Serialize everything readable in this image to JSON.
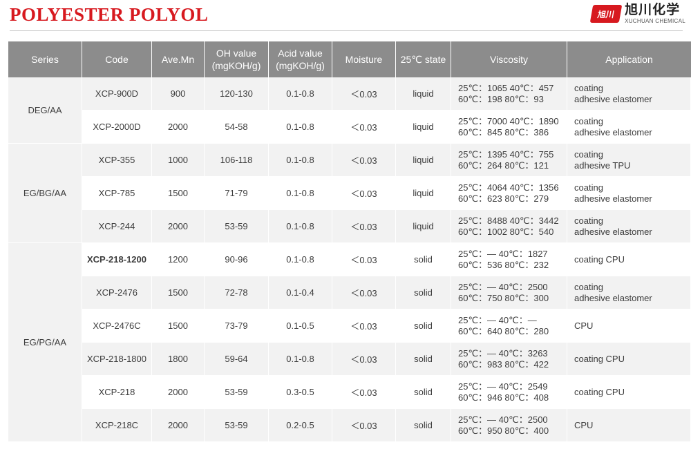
{
  "header": {
    "title": "POLYESTER POLYOL",
    "logo_badge": "旭川",
    "logo_cn": "旭川化学",
    "logo_en": "XUCHUAN CHEMICAL"
  },
  "table": {
    "headers": [
      "Series",
      "Code",
      "Ave.Mn",
      "OH value\n(mgKOH/g)",
      "Acid value\n(mgKOH/g)",
      "Moisture",
      "25℃ state",
      "Viscosity",
      "Application"
    ],
    "groups": [
      {
        "series": "DEG/AA",
        "rows": [
          {
            "code": "XCP-900D",
            "mn": "900",
            "oh": "120-130",
            "acid": "0.1-0.8",
            "moisture": "＜0.03",
            "state": "liquid",
            "visc1": "25℃：1065   40℃：457",
            "visc2": "60℃：198     80℃：93",
            "app1": "coating",
            "app2": "adhesive elastomer"
          },
          {
            "code": "XCP-2000D",
            "mn": "2000",
            "oh": "54-58",
            "acid": "0.1-0.8",
            "moisture": "＜0.03",
            "state": "liquid",
            "visc1": "25℃：7000   40℃：1890",
            "visc2": "60℃：845     80℃：386",
            "app1": "coating",
            "app2": "adhesive elastomer"
          }
        ]
      },
      {
        "series": "EG/BG/AA",
        "rows": [
          {
            "code": "XCP-355",
            "mn": "1000",
            "oh": "106-118",
            "acid": "0.1-0.8",
            "moisture": "＜0.03",
            "state": "liquid",
            "visc1": "25℃：1395  40℃：755",
            "visc2": "60℃：264    80℃：121",
            "app1": "coating",
            "app2": "adhesive TPU"
          },
          {
            "code": "XCP-785",
            "mn": "1500",
            "oh": "71-79",
            "acid": "0.1-0.8",
            "moisture": "＜0.03",
            "state": "liquid",
            "visc1": "25℃：4064 40℃：1356",
            "visc2": "60℃：623    80℃：279",
            "app1": "coating",
            "app2": "adhesive elastomer"
          },
          {
            "code": "XCP-244",
            "mn": "2000",
            "oh": "53-59",
            "acid": "0.1-0.8",
            "moisture": "＜0.03",
            "state": "liquid",
            "visc1": "25℃：8488  40℃：3442",
            "visc2": "60℃：1002  80℃：540",
            "app1": "coating",
            "app2": "adhesive elastomer"
          }
        ]
      },
      {
        "series": "EG/PG/AA",
        "rows": [
          {
            "code": "XCP-218-1200",
            "bold": true,
            "mn": "1200",
            "oh": "90-96",
            "acid": "0.1-0.8",
            "moisture": "＜0.03",
            "state": "solid",
            "visc1": "25℃：—      40℃：1827",
            "visc2": "60℃：536  80℃：232",
            "app1": "coating CPU",
            "app2": ""
          },
          {
            "code": "XCP-2476",
            "mn": "1500",
            "oh": "72-78",
            "acid": "0.1-0.4",
            "moisture": "＜0.03",
            "state": "solid",
            "visc1": "25℃：—     40℃：2500",
            "visc2": "60℃：750  80℃：300",
            "app1": "coating",
            "app2": "adhesive elastomer"
          },
          {
            "code": "XCP-2476C",
            "mn": "1500",
            "oh": "73-79",
            "acid": "0.1-0.5",
            "moisture": "＜0.03",
            "state": "solid",
            "visc1": "25℃：—      40℃：—",
            "visc2": "60℃：640  80℃：280",
            "app1": "CPU",
            "app2": ""
          },
          {
            "code": "XCP-218-1800",
            "mn": "1800",
            "oh": "59-64",
            "acid": "0.1-0.8",
            "moisture": "＜0.03",
            "state": "solid",
            "visc1": "25℃：—      40℃：3263",
            "visc2": "60℃：983  80℃：422",
            "app1": "coating CPU",
            "app2": ""
          },
          {
            "code": "XCP-218",
            "mn": "2000",
            "oh": "53-59",
            "acid": "0.3-0.5",
            "moisture": "＜0.03",
            "state": "solid",
            "visc1": "25℃：—          40℃：2549",
            "visc2": "60℃：946      80℃：408",
            "app1": "coating CPU",
            "app2": ""
          },
          {
            "code": "XCP-218C",
            "mn": "2000",
            "oh": "53-59",
            "acid": "0.2-0.5",
            "moisture": "＜0.03",
            "state": "solid",
            "visc1": "25℃：—          40℃：2500",
            "visc2": "60℃：950      80℃：400",
            "app1": "CPU",
            "app2": ""
          }
        ]
      }
    ]
  }
}
